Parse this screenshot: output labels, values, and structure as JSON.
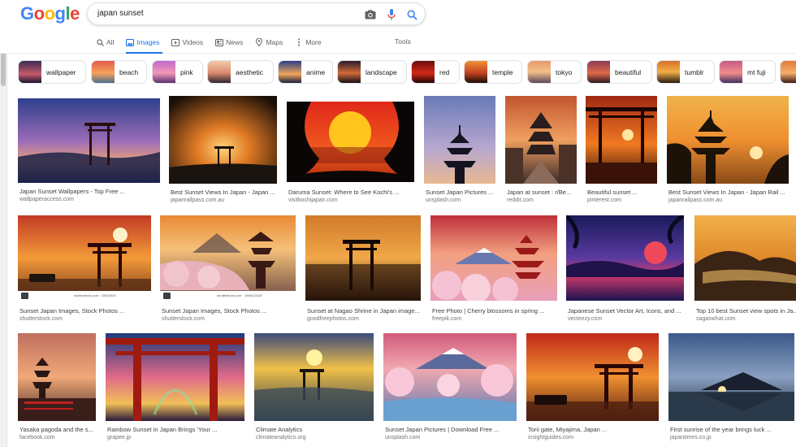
{
  "logo": [
    "G",
    "o",
    "o",
    "g",
    "l",
    "e"
  ],
  "logo_colors": [
    "#4285f4",
    "#ea4335",
    "#fbbc05",
    "#4285f4",
    "#34a853",
    "#ea4335"
  ],
  "search": {
    "query": "japan sunset"
  },
  "tabs": [
    {
      "label": "All",
      "icon": "search-icon"
    },
    {
      "label": "Images",
      "icon": "image-icon",
      "active": true
    },
    {
      "label": "Videos",
      "icon": "play-icon"
    },
    {
      "label": "News",
      "icon": "news-icon"
    },
    {
      "label": "Maps",
      "icon": "pin-icon"
    },
    {
      "label": "More",
      "icon": "dots-icon"
    }
  ],
  "tools_label": "Tools",
  "chips": [
    "wallpaper",
    "beach",
    "pink",
    "aesthetic",
    "anime",
    "landscape",
    "red",
    "temple",
    "tokyo",
    "beautiful",
    "tumblr",
    "mt fuji"
  ],
  "results": [
    {
      "title": "Japan Sunset Wallpapers - Top Free ...",
      "source": "wallpaperaccess.com"
    },
    {
      "title": "Best Sunset Views In Japan - Japan ...",
      "source": "japanrailpass.com.au"
    },
    {
      "title": "Daruma Sunset: Where to See Kochi's ...",
      "source": "visitkochijapan.com"
    },
    {
      "title": "Sunset Japan Pictures ...",
      "source": "unsplash.com"
    },
    {
      "title": "Japan at sunset : r/Be...",
      "source": "reddit.com"
    },
    {
      "title": "Beautiful sunset ...",
      "source": "pinterest.com"
    },
    {
      "title": "Best Sunset Views In Japan - Japan Rail ...",
      "source": "japanrailpass.com.au"
    },
    {
      "title": "Sunset Japan Images, Stock Photos ...",
      "source": "shutterstock.com",
      "watermark": "shutterstock.com · 22620319"
    },
    {
      "title": "Sunset Japan Images, Stock Photos ...",
      "source": "shutterstock.com",
      "watermark": "shutterstock.com · 1966124187"
    },
    {
      "title": "Sunset at Nagao Shrine in Japan image...",
      "source": "goodfreephotos.com"
    },
    {
      "title": "Free Photo | Cherry blossoms in spring ...",
      "source": "freepik.com"
    },
    {
      "title": "Japanese Sunset Vector Art, Icons, and ...",
      "source": "vecteezy.com"
    },
    {
      "title": "Top 10 best Sunset view spots in Ja...",
      "source": "sagaswhat.com"
    },
    {
      "title": "Yasaka pagoda and the s...",
      "source": "facebook.com"
    },
    {
      "title": "Rainbow Sunset in Japan Brings 'Your ...",
      "source": "grapee.jp"
    },
    {
      "title": "Climate Analytics",
      "source": "climateanalytics.org"
    },
    {
      "title": "Sunset Japan Pictures | Download Free ...",
      "source": "unsplash.com"
    },
    {
      "title": "Torii gate, Miyajima, Japan ...",
      "source": "insightguides.com"
    },
    {
      "title": "First sunrise of the year brings luck ...",
      "source": "japantimes.co.jp"
    }
  ]
}
